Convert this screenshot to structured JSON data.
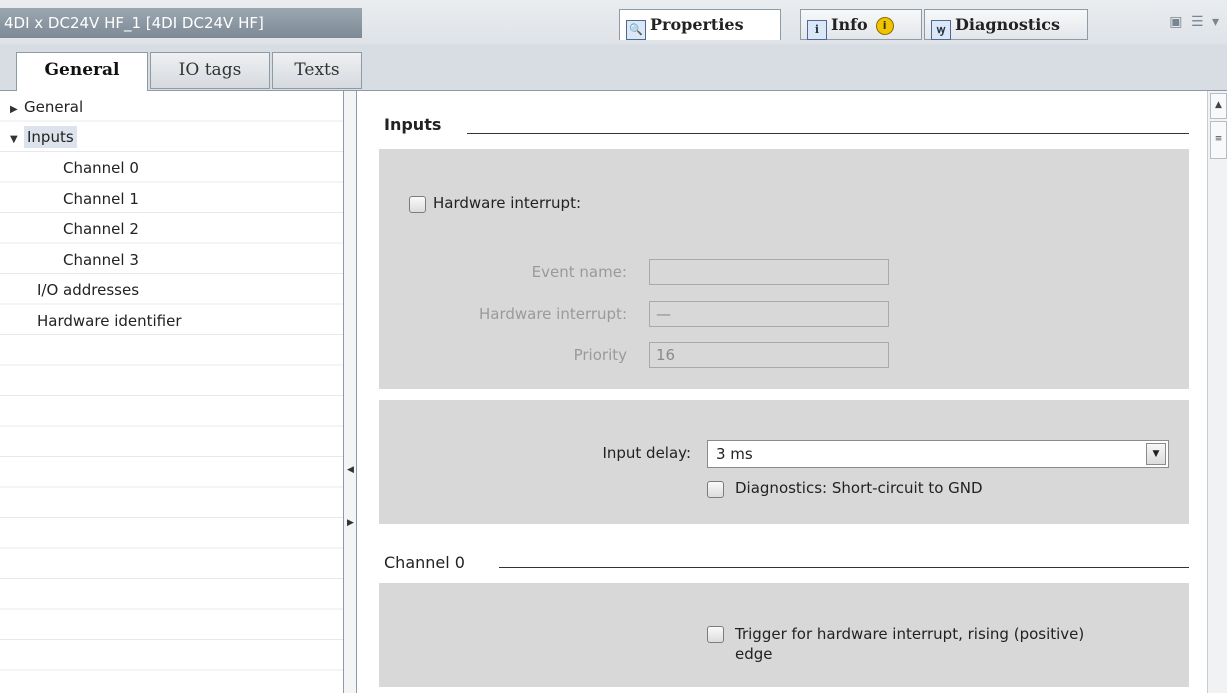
{
  "window": {
    "title": "4DI x DC24V HF_1 [4DI DC24V HF]",
    "tabs": {
      "properties": "Properties",
      "info": "Info",
      "diagnostics": "Diagnostics"
    },
    "info_badge": "i"
  },
  "subtabs": {
    "general": "General",
    "io_tags": "IO tags",
    "texts": "Texts"
  },
  "tree": {
    "general": "General",
    "inputs": "Inputs",
    "channel0": "Channel 0",
    "channel1": "Channel 1",
    "channel2": "Channel 2",
    "channel3": "Channel 3",
    "io_addresses": "I/O addresses",
    "hardware_identifier": "Hardware identifier"
  },
  "inputs_section": {
    "heading": "Inputs",
    "hardware_interrupt_checkbox": "Hardware interrupt:",
    "event_name_label": "Event name:",
    "event_name_value": "",
    "hw_interrupt_label": "Hardware interrupt:",
    "hw_interrupt_value": "—",
    "priority_label": "Priority",
    "priority_value": "16",
    "input_delay_label": "Input delay:",
    "input_delay_value": "3 ms",
    "diag_short_circuit": "Diagnostics: Short-circuit to GND"
  },
  "channel0_section": {
    "heading": "Channel 0",
    "trigger_line1": "Trigger for hardware interrupt, rising (positive)",
    "trigger_line2": "edge"
  },
  "colors": {
    "panel_bg": "#d8d8d8",
    "title_bg": "#8a96a0",
    "selected_bg": "#dce3ec"
  }
}
